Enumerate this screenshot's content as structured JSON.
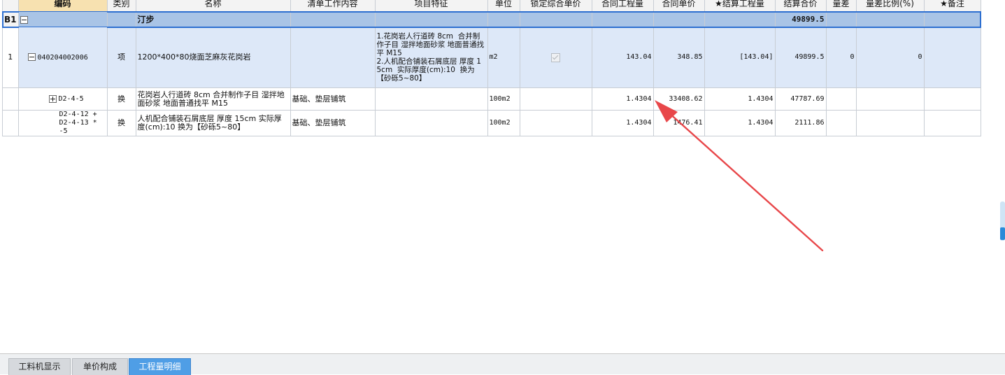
{
  "columns": [
    "编码",
    "类别",
    "名称",
    "清单工作内容",
    "项目特征",
    "单位",
    "锁定综合单价",
    "合同工程量",
    "合同单价",
    "★结算工程量",
    "结算合价",
    "量差",
    "量差比例(%)",
    "★备注"
  ],
  "rows": {
    "group": {
      "row_label": "B1",
      "name": "汀步",
      "total": "49899.5"
    },
    "main": {
      "row_label": "1",
      "code": "040204002006",
      "category": "项",
      "name": "1200*400*80烧面芝麻灰花岗岩",
      "features": "1.花岗岩人行道砖 8cm  合并制作子目 湿拌地面砂浆 地面普通找平 M15\n2.人机配合铺装石屑底层 厚度 15cm  实际厚度(cm):10  换为【砂砾5~80】",
      "unit": "m2",
      "locked_price_checked": true,
      "contract_qty": "143.04",
      "contract_price": "348.85",
      "settle_qty": "[143.04]",
      "settle_total": "49899.5",
      "qty_diff": "0",
      "qty_diff_ratio": "0"
    },
    "sub1": {
      "code": "D2-4-5",
      "category": "换",
      "name": "花岗岩人行道砖 8cm  合并制作子目 湿拌地面砂浆 地面普通找平 M15",
      "work": "基础、垫层铺筑",
      "unit": "100m2",
      "contract_qty": "1.4304",
      "contract_price": "33408.62",
      "settle_qty": "1.4304",
      "settle_total": "47787.69"
    },
    "sub2": {
      "code_line1": "D2-4-12 +",
      "code_line2": "D2-4-13 * -5",
      "category": "换",
      "name": "人机配合铺装石屑底层 厚度 15cm  实际厚度(cm):10  换为【砂砾5~80】",
      "work": "基础、垫层铺筑",
      "unit": "100m2",
      "contract_qty": "1.4304",
      "contract_price": "1476.41",
      "settle_qty": "1.4304",
      "settle_total": "2111.86"
    }
  },
  "tabs": [
    "工料机显示",
    "单价构成",
    "工程量明细"
  ],
  "active_tab": "工程量明细",
  "colors": {
    "header_bg": "#f3f3f3",
    "sorted_header_bg": "#f7e1b0",
    "group_row_bg": "#a9c4e6",
    "main_row_bg": "#dde8f8",
    "active_tab": "#4f9ee6",
    "annotation_arrow": "#e8474a"
  }
}
